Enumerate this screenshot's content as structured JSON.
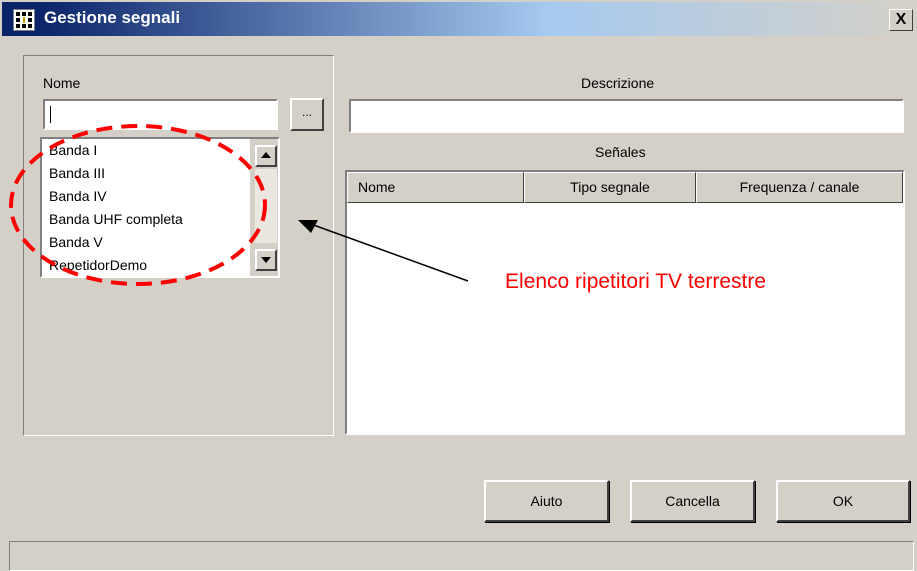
{
  "window": {
    "title": "Gestione segnali",
    "close_label": "X",
    "icon": "app-grid-icon"
  },
  "left_panel": {
    "name_label": "Nome",
    "name_value": "",
    "browse_label": "...",
    "list_items": [
      "Banda I",
      "Banda III",
      "Banda IV",
      "Banda UHF completa",
      "Banda V",
      "RepetidorDemo"
    ]
  },
  "right_panel": {
    "description_label": "Descrizione",
    "description_value": "",
    "signals_label": "Señales",
    "columns": [
      "Nome",
      "Tipo segnale",
      "Frequenza / canale"
    ]
  },
  "buttons": {
    "help": "Aiuto",
    "cancel": "Cancella",
    "ok": "OK"
  },
  "annotation": {
    "text": "Elenco ripetitori TV terrestre",
    "color": "#ff0000"
  }
}
